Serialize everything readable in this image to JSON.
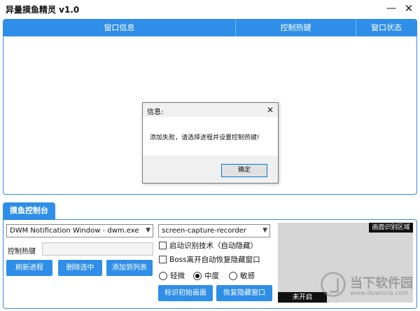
{
  "window": {
    "title": "异量摸鱼精灵 v1.0",
    "minimize_glyph": "—",
    "close_glyph": "✕"
  },
  "table": {
    "columns": [
      "窗口信息",
      "控制热键",
      "窗口状态"
    ]
  },
  "dialog": {
    "title": "信息:",
    "close_glyph": "✕",
    "message": "添加失败，请选择进程并设置控制热键!",
    "ok_label": "确定"
  },
  "console": {
    "tab_label": "摸鱼控制台",
    "process_select": {
      "value": "DWM Notification Window - dwm.exe"
    },
    "app_select": {
      "value": "screen-capture-recorder"
    },
    "hotkey_label": "控制热键",
    "hotkey_value": "",
    "buttons": {
      "refresh": "刷新进程",
      "delete": "删除选中",
      "add": "添加到列表",
      "mark": "标识初始画面",
      "restore": "恢复隐藏窗口"
    },
    "checkboxes": {
      "recognition": {
        "label": "启动识别技术（自动隐藏）",
        "checked": false
      },
      "boss_restore": {
        "label": "Boss离开自动恢复隐藏窗口",
        "checked": false
      }
    },
    "sensitivity": {
      "options": [
        "轻微",
        "中度",
        "敏感"
      ],
      "selected": "中度"
    },
    "preview": {
      "tag": "画面识别区域",
      "status": "未开启"
    }
  },
  "watermark": {
    "text": "当下软件园",
    "url": "www.downxia.com"
  },
  "icons": {
    "dropdown": "chevron-down-icon",
    "radio_selected": "radio-dot-icon"
  }
}
